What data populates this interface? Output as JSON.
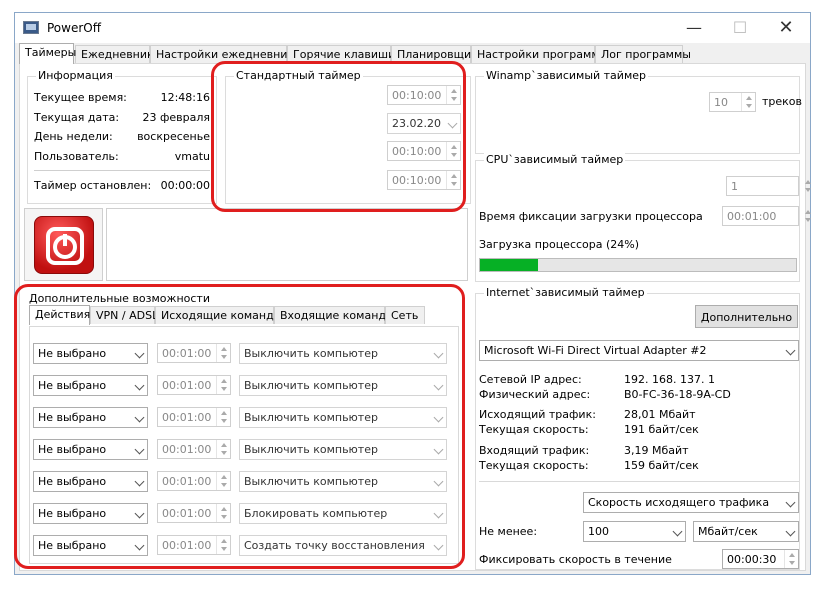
{
  "window": {
    "title": "PowerOff"
  },
  "tabs": [
    "Таймеры",
    "Ежедневник",
    "Настройки ежедневника",
    "Горячие клавиши",
    "Планировщик",
    "Настройки программы",
    "Лог программы"
  ],
  "info": {
    "title": "Информация",
    "rows": [
      {
        "label": "Текущее время:",
        "value": "12:48:16"
      },
      {
        "label": "Текущая дата:",
        "value": "23 февраля"
      },
      {
        "label": "День недели:",
        "value": "воскресенье"
      },
      {
        "label": "Пользователь:",
        "value": "vmatu"
      }
    ],
    "timer_label": "Таймер остановлен:",
    "timer_value": "00:00:00"
  },
  "std_timer": {
    "title": "Стандартный таймер",
    "field1": "00:10:00",
    "date": "23.02.20",
    "field3": "00:10:00",
    "field4": "00:10:00"
  },
  "winamp": {
    "title": "Winamp`зависимый таймер",
    "tracks": "10",
    "tracks_label": "треков"
  },
  "cpu": {
    "title": "CPU`зависимый таймер",
    "value": "1",
    "fix_label": "Время фиксации загрузки процессора",
    "fix_value": "00:01:00",
    "load_label": "Загрузка процессора (24%)",
    "load_percent": 24,
    "bar_color": "#06b025"
  },
  "extra": {
    "title": "Дополнительные возможности",
    "subtabs": [
      "Действия",
      "VPN / ADSL",
      "Исходящие команды",
      "Входящие команды",
      "Сеть"
    ],
    "rows": [
      {
        "select": "Не выбрано",
        "time": "00:01:00",
        "action": "Выключить компьютер"
      },
      {
        "select": "Не выбрано",
        "time": "00:01:00",
        "action": "Выключить компьютер"
      },
      {
        "select": "Не выбрано",
        "time": "00:01:00",
        "action": "Выключить компьютер"
      },
      {
        "select": "Не выбрано",
        "time": "00:01:00",
        "action": "Выключить компьютер"
      },
      {
        "select": "Не выбрано",
        "time": "00:01:00",
        "action": "Выключить компьютер"
      },
      {
        "select": "Не выбрано",
        "time": "00:01:00",
        "action": "Блокировать компьютер"
      },
      {
        "select": "Не выбрано",
        "time": "00:01:00",
        "action": "Создать точку восстановления"
      }
    ]
  },
  "internet": {
    "title": "Internet`зависимый таймер",
    "more_button": "Дополнительно",
    "adapter": "Microsoft Wi-Fi Direct Virtual Adapter #2",
    "info": [
      {
        "label": "Сетевой IP адрес:",
        "value": "192. 168. 137. 1"
      },
      {
        "label": "Физический адрес:",
        "value": "B0-FC-36-18-9A-CD"
      },
      {
        "label": "Исходящий трафик:",
        "value": "28,01 Мбайт"
      },
      {
        "label": "Текущая скорость:",
        "value": "191 байт/сек"
      },
      {
        "label": "Входящий трафик:",
        "value": "3,19 Мбайт"
      },
      {
        "label": "Текущая скорость:",
        "value": "159 байт/сек"
      }
    ],
    "speed_type": "Скорость исходящего трафика",
    "min_label": "Не менее:",
    "min_value": "100",
    "unit": "Мбайт/сек",
    "fix_label": "Фиксировать скорость в течение",
    "fix_value": "00:00:30"
  },
  "colors": {
    "highlight": "#e01e1e",
    "power_button": "#d42020"
  }
}
